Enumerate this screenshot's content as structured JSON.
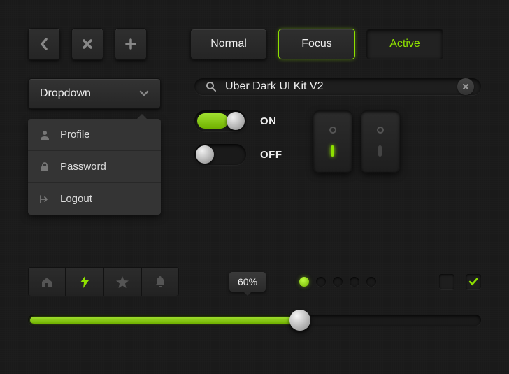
{
  "accent": "#8ee000",
  "buttons": {
    "normal": "Normal",
    "focus": "Focus",
    "active": "Active"
  },
  "dropdown": {
    "label": "Dropdown",
    "items": [
      {
        "label": "Profile"
      },
      {
        "label": "Password"
      },
      {
        "label": "Logout"
      }
    ]
  },
  "search": {
    "value": "Uber Dark UI Kit V2"
  },
  "toggles": {
    "on_label": "ON",
    "off_label": "OFF"
  },
  "tooltip": {
    "value": "60%"
  },
  "slider": {
    "percent": 60
  },
  "radios": {
    "selected_index": 0,
    "count": 5
  },
  "checkboxes": {
    "unchecked": false,
    "checked": true
  }
}
